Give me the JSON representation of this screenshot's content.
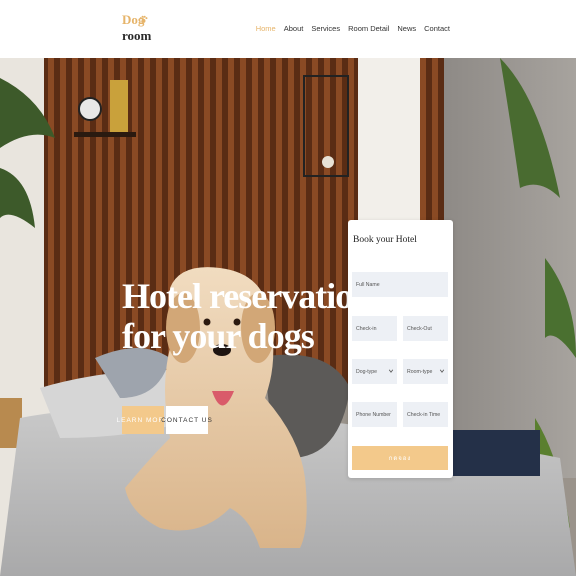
{
  "brand": {
    "line1": "Dog",
    "line2": "room"
  },
  "nav": [
    {
      "label": "Home",
      "active": true
    },
    {
      "label": "About",
      "active": false
    },
    {
      "label": "Services",
      "active": false
    },
    {
      "label": "Room Detail",
      "active": false
    },
    {
      "label": "News",
      "active": false
    },
    {
      "label": "Contact",
      "active": false
    }
  ],
  "hero": {
    "title_line1": "Hotel reservations",
    "title_line2": "for your dogs",
    "learn_more": "LEARN MORE",
    "contact_us": "CONTACT US"
  },
  "booking": {
    "title": "Book your Hotel",
    "full_name": "Full Name",
    "check_in": "Check-in",
    "check_out": "Check-Out",
    "dog_type": "Dog-type",
    "room_type": "Room-type",
    "phone": "Phone Number",
    "checkin_time": "Check-in Time",
    "submit": "กดจอง"
  },
  "colors": {
    "accent": "#f3c98b",
    "nav_active": "#e6b46a"
  }
}
